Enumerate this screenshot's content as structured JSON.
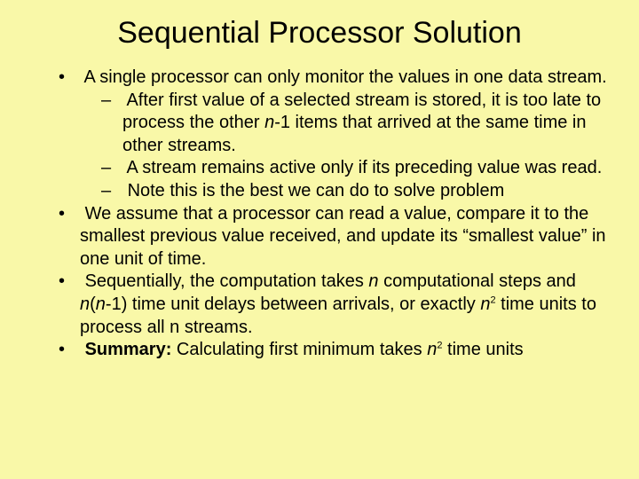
{
  "title": "Sequential Processor Solution",
  "b1": "A single processor can only monitor the values in one data stream.",
  "b1a_pre": "After first value of a selected stream is stored, it is too late to process the other ",
  "b1a_var": "n",
  "b1a_post": "-1 items that arrived at the same time in other streams.",
  "b1b": "A stream remains active only if its preceding value was read.",
  "b1c": "Note this is the best we can do to solve problem",
  "b2": "We assume that a processor can read a value, compare it to the smallest previous value received, and update its “smallest value” in one unit of time.",
  "b3_pre": "Sequentially, the computation takes ",
  "b3_n1": "n",
  "b3_mid1": " computational steps and ",
  "b3_n2": "n",
  "b3_paren": "(",
  "b3_n3": "n",
  "b3_mid2": "-1) time unit delays  between arrivals, or exactly ",
  "b3_n4": "n",
  "b3_sup1": "2",
  "b3_post": " time units to process all n streams.",
  "b4_label": "Summary:",
  "b4_mid": " Calculating first minimum takes ",
  "b4_n": "n",
  "b4_sup": "2",
  "b4_post": " time units"
}
